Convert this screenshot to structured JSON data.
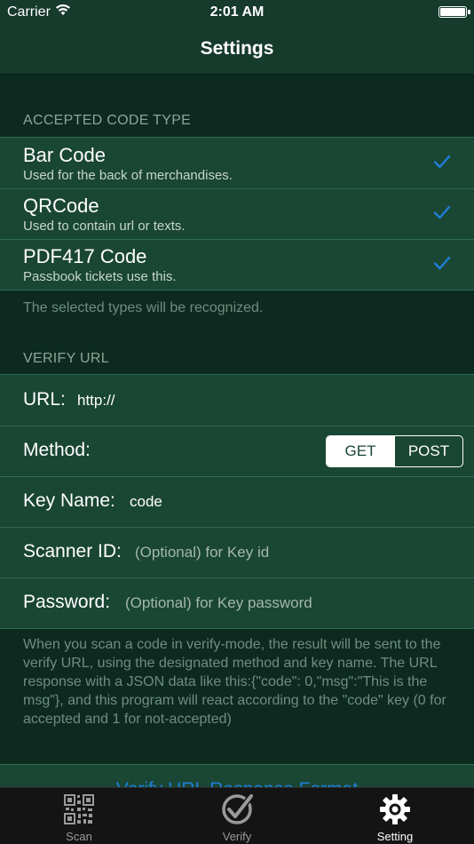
{
  "status_bar": {
    "carrier": "Carrier",
    "time": "2:01 AM"
  },
  "nav": {
    "title": "Settings"
  },
  "code_types": {
    "header": "ACCEPTED CODE TYPE",
    "items": [
      {
        "title": "Bar Code",
        "subtitle": "Used for the back of merchandises.",
        "checked": true
      },
      {
        "title": "QRCode",
        "subtitle": "Used to contain url or texts.",
        "checked": true
      },
      {
        "title": "PDF417 Code",
        "subtitle": "Passbook tickets use this.",
        "checked": true
      }
    ],
    "footer": "The selected types will be recognized."
  },
  "verify": {
    "header": "VERIFY URL",
    "url_label": "URL:",
    "url_value": "http://",
    "method_label": "Method:",
    "method_options": [
      "GET",
      "POST"
    ],
    "method_selected": "GET",
    "key_name_label": "Key Name:",
    "key_name_value": "code",
    "scanner_id_label": "Scanner ID:",
    "scanner_id_placeholder": "(Optional) for Key id",
    "password_label": "Password:",
    "password_placeholder": "(Optional) for Key password",
    "footer": "When you scan a code in verify-mode, the result will be sent to the verify URL, using the designated method and key name. The URL response with a JSON data like this:{\"code\": 0,\"msg\":\"This is the msg\"}, and this program will react according to the \"code\" key (0 for accepted and 1 for not-accepted)",
    "response_format_link": "Verify URL Response Format"
  },
  "tabs": [
    {
      "label": "Scan",
      "icon": "qr-code-icon",
      "active": false
    },
    {
      "label": "Verify",
      "icon": "verify-check-icon",
      "active": false
    },
    {
      "label": "Setting",
      "icon": "gear-icon",
      "active": true
    }
  ],
  "colors": {
    "accent": "#1f7fd8",
    "background": "#0c2a1f",
    "cell": "#1a4634"
  }
}
